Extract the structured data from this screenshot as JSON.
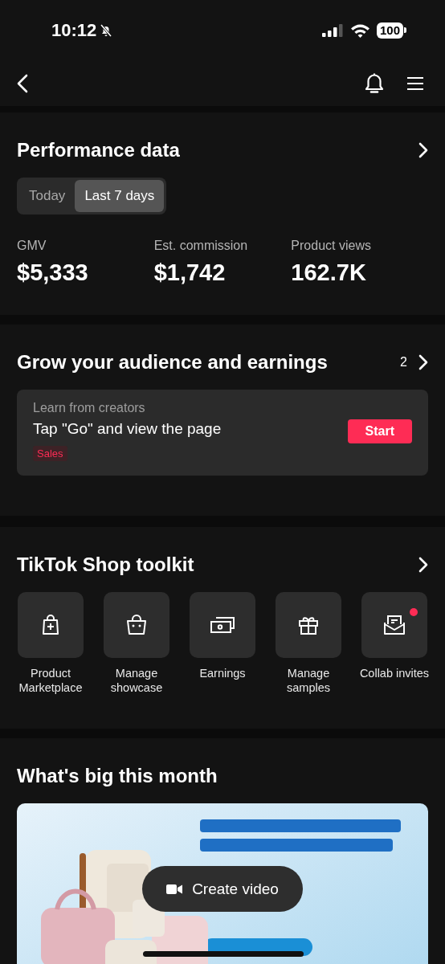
{
  "status_bar": {
    "time": "10:12",
    "silent": true,
    "battery": "100"
  },
  "performance": {
    "title": "Performance data",
    "ranges": [
      {
        "label": "Today",
        "selected": false
      },
      {
        "label": "Last 7 days",
        "selected": true
      }
    ],
    "metrics": [
      {
        "label": "GMV",
        "value": "$5,333"
      },
      {
        "label": "Est. commission",
        "value": "$1,742"
      },
      {
        "label": "Product views",
        "value": "162.7K"
      }
    ]
  },
  "grow": {
    "title": "Grow your audience and earnings",
    "count": "2",
    "card": {
      "eyebrow": "Learn from creators",
      "text": "Tap \"Go\" and view the page",
      "tag": "Sales",
      "action": "Start"
    }
  },
  "toolkit": {
    "title": "TikTok Shop toolkit",
    "tools": [
      {
        "kind": "marketplace",
        "label": "Product Marketplace",
        "badge": false
      },
      {
        "kind": "showcase",
        "label": "Manage showcase",
        "badge": false
      },
      {
        "kind": "earnings",
        "label": "Earnings",
        "badge": false
      },
      {
        "kind": "samples",
        "label": "Manage samples",
        "badge": false
      },
      {
        "kind": "invites",
        "label": "Collab invites",
        "badge": true
      }
    ]
  },
  "big": {
    "title": "What's big this month"
  },
  "floating_button": {
    "label": "Create video"
  }
}
